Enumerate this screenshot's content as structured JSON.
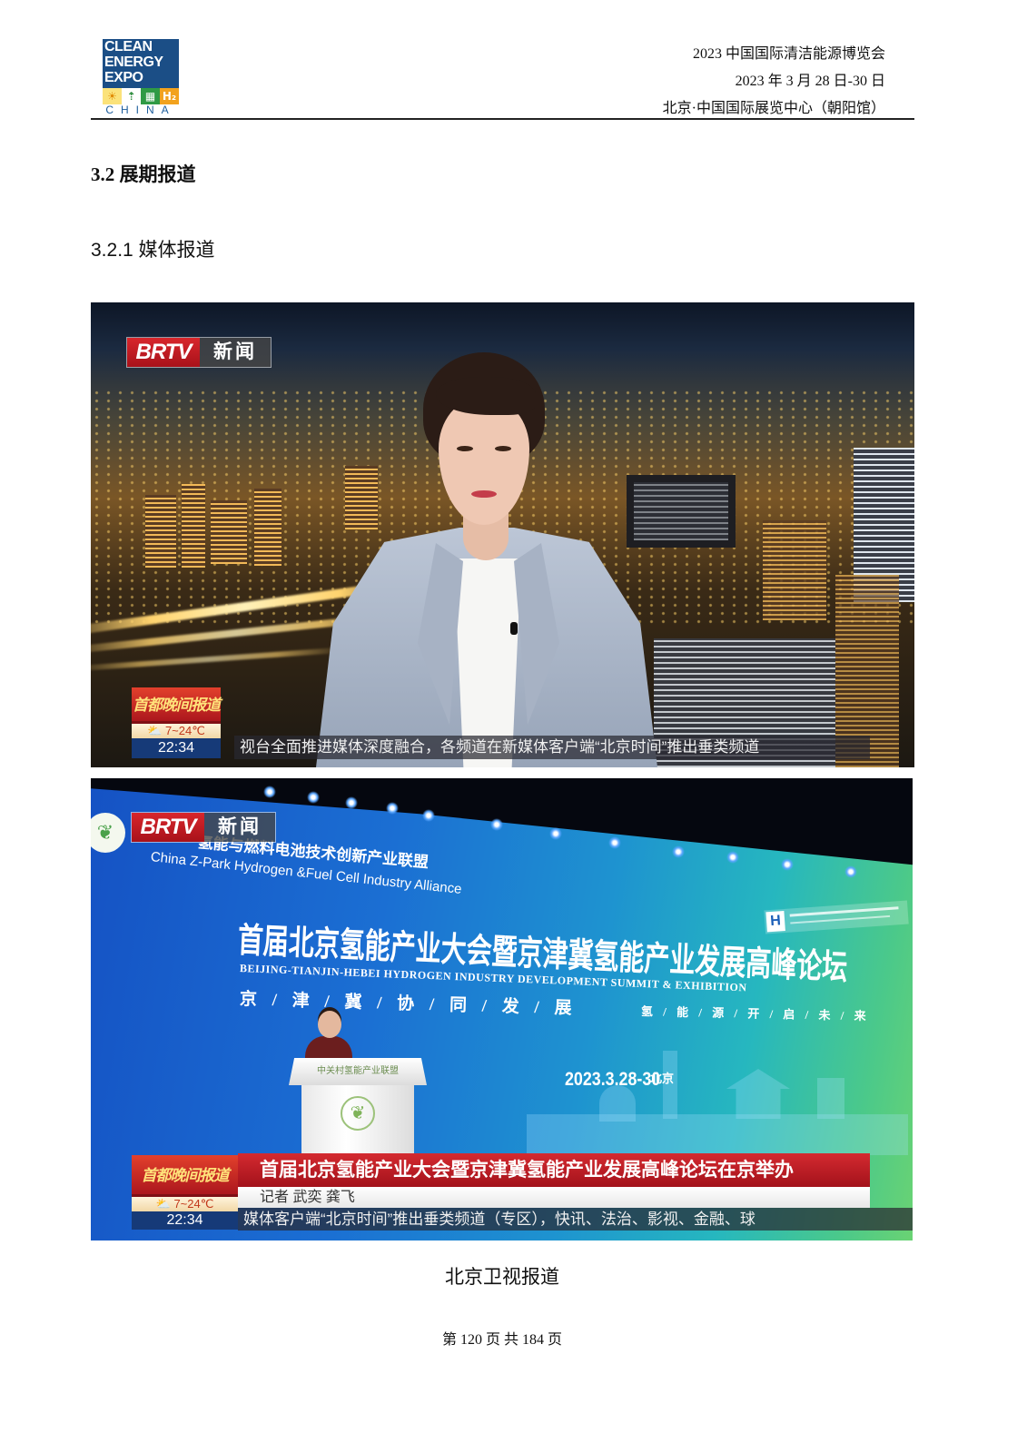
{
  "header": {
    "logo": {
      "lines": [
        "CLEAN",
        "ENERGY",
        "EXPO"
      ],
      "country": "CHINA",
      "icons": [
        "sun-icon",
        "wind-icon",
        "building-icon",
        "hydrogen-icon"
      ],
      "brand_color": "#1b4e86"
    },
    "expo_name": "2023 中国国际清洁能源博览会",
    "dates": "2023 年 3 月 28 日-30 日",
    "venue": "北京·中国国际展览中心（朝阳馆）"
  },
  "section": {
    "heading": "3.2 展期报道",
    "subheading": "3.2.1 媒体报道"
  },
  "photo1": {
    "channel": {
      "brand": "BRTV",
      "name": "新闻"
    },
    "program": "首都晚间报道",
    "weather": "7~24℃",
    "time": "22:34",
    "ticker": "视台全面推进媒体深度融合，各频道在新媒体客户端“北京时间”推出垂类频道"
  },
  "photo2": {
    "channel": {
      "brand": "BRTV",
      "name": "新闻"
    },
    "alliance_cn": "氢能与燃料电池技术创新产业联盟",
    "alliance_en": "China Z-Park Hydrogen &Fuel Cell Industry Alliance",
    "stage_title": "首届北京氢能产业大会暨京津冀氢能产业发展高峰论坛",
    "stage_title_en": "BEIJING-TIANJIN-HEBEI HYDROGEN INDUSTRY DEVELOPMENT SUMMIT & EXHIBITION",
    "slogan_1": "京 / 津 / 冀 / 协 / 同 / 发 / 展",
    "slogan_2": "氢 / 能 / 源 / 开 / 启 / 未 / 来",
    "stage_date": "2023.3.28-30",
    "stage_city": "北京",
    "podium_label": "中关村氢能产业联盟",
    "program": "首都晚间报道",
    "weather": "7~24℃",
    "time": "22:34",
    "headline": "首届北京氢能产业大会暨京津冀氢能产业发展高峰论坛在京举办",
    "reporters": "记者 武奕 龚飞",
    "ticker": "媒体客户端“北京时间”推出垂类频道（专区），快讯、法治、影视、金融、球"
  },
  "caption": "北京卫视报道",
  "footer": "第 120 页 共 184 页"
}
